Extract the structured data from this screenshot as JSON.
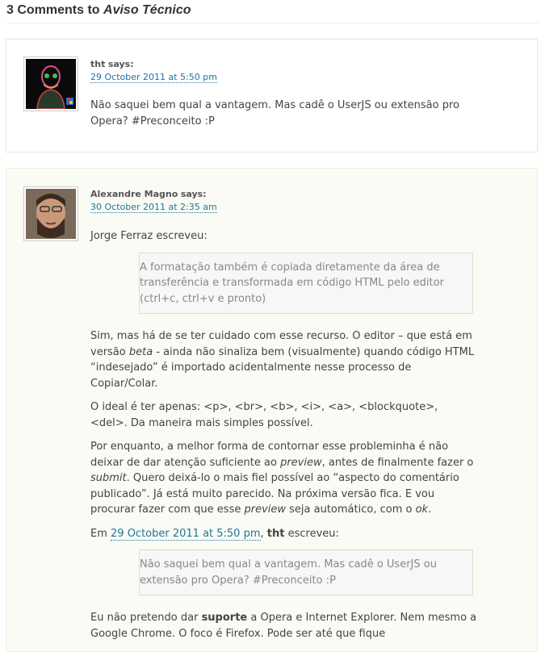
{
  "heading": {
    "count_text": "3 Comments to ",
    "post_title": "Aviso Técnico"
  },
  "comments": [
    {
      "author": "tht",
      "says": "says:",
      "date": "29 October 2011 at 5:50 pm",
      "text": "Não saquei bem qual a vantagem. Mas cadê o UserJS ou extensão pro Opera? #Preconceito :P"
    },
    {
      "author": "Alexandre Magno",
      "says": "says:",
      "date": "30 October 2011 at 2:35 am",
      "intro": "Jorge Ferraz escreveu:",
      "quote1": "A formatação também é copiada diretamente da área de transferência e transformada em código HTML pelo editor (ctrl+c, ctrl+v e pronto)",
      "p1_a": "Sim, mas há de se ter cuidado com esse recurso. O editor – que está em versão ",
      "p1_em": "beta",
      "p1_b": " - ainda não sinaliza bem (visualmente) quando código HTML “indesejado” é importado acidentalmente nesse processo de Copiar/Colar.",
      "p2": "O ideal é ter apenas: <p>, <br>, <b>, <i>, <a>, <blockquote>, <del>. Da maneira mais simples possível.",
      "p3_a": "Por enquanto, a melhor forma de contornar esse probleminha é não deixar de dar atenção suficiente ao ",
      "p3_em1": "preview",
      "p3_b": ", antes de finalmente fazer o ",
      "p3_em2": "submit",
      "p3_c": ". Quero deixá-lo o mais fiel possível ao “aspecto do comentário publicado”. Já está muito parecido. Na próxima versão fica. E vou procurar fazer com que esse ",
      "p3_em3": "preview",
      "p3_d": " seja automático, com o ",
      "p3_em4": "ok",
      "p3_e": ".",
      "cite_prefix": "Em ",
      "cite_date": "29 October 2011 at 5:50 pm",
      "cite_sep": ", ",
      "cite_author": "tht",
      "cite_suffix": " escreveu:",
      "quote2": "Não saquei bem qual a vantagem. Mas cadê o UserJS ou extensão pro Opera? #Preconceito :P",
      "p4_a": "Eu não pretendo dar ",
      "p4_strong": "suporte",
      "p4_b": " a Opera e Internet Explorer. Nem mesmo a Google Chrome. O foco é Firefox. Pode ser até que fique"
    }
  ]
}
